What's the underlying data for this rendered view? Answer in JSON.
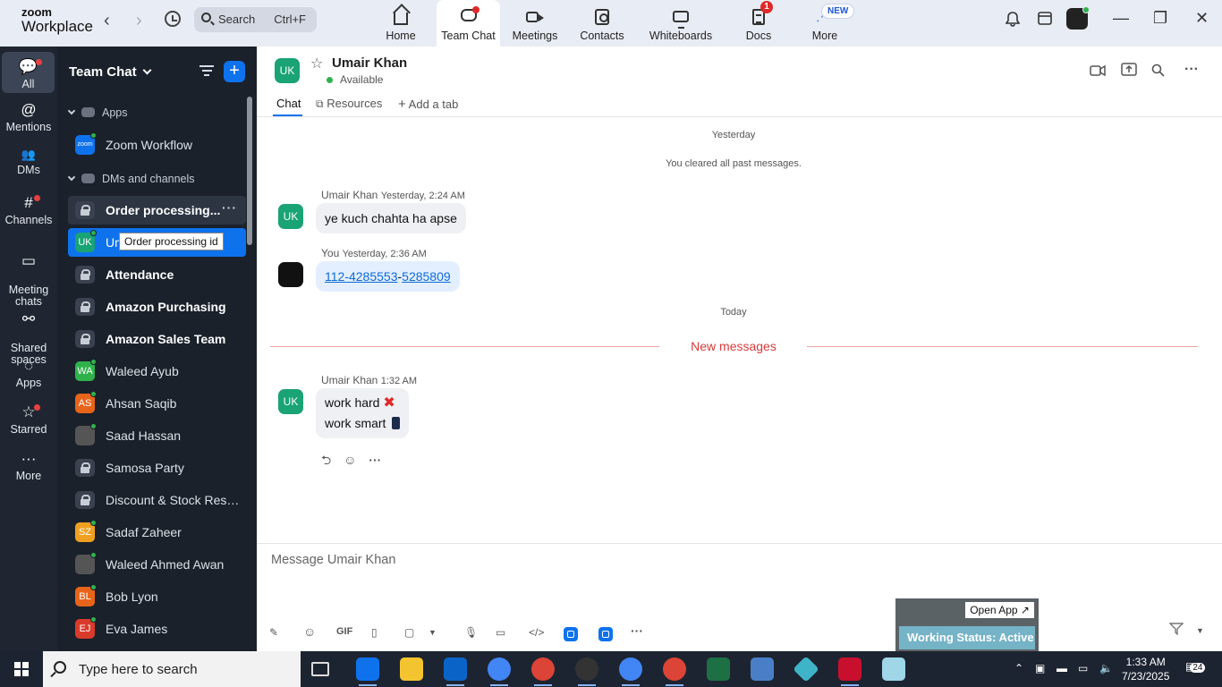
{
  "app": {
    "logo_line1": "zoom",
    "logo_line2": "Workplace"
  },
  "topbar": {
    "back": "‹",
    "forward": "›",
    "search": {
      "label": "Search",
      "shortcut": "Ctrl+F"
    },
    "tabs": [
      {
        "label": "Home"
      },
      {
        "label": "Team Chat"
      },
      {
        "label": "Meetings"
      },
      {
        "label": "Contacts"
      },
      {
        "label": "Whiteboards"
      },
      {
        "label": "Docs",
        "badge": "1"
      },
      {
        "label": "More",
        "badge": "NEW"
      }
    ],
    "window": {
      "minimize": "—",
      "restore": "❐",
      "close": "✕"
    }
  },
  "rail": [
    {
      "label": "All",
      "glyph": "💬"
    },
    {
      "label": "Mentions",
      "glyph": "@"
    },
    {
      "label": "DMs",
      "glyph": "👥"
    },
    {
      "label": "Channels",
      "glyph": "#"
    },
    {
      "label": "Meeting\nchats",
      "glyph": "▭"
    },
    {
      "label": "Shared\nspaces",
      "glyph": "⚯"
    },
    {
      "label": "Apps",
      "glyph": "◌"
    },
    {
      "label": "Starred",
      "glyph": "☆"
    },
    {
      "label": "More",
      "glyph": "···"
    }
  ],
  "channel_panel": {
    "title": "Team Chat",
    "plus": "+",
    "sections": {
      "apps": "Apps",
      "dms": "DMs and channels"
    },
    "apps": [
      {
        "name": "Zoom Workflow",
        "avatar": "zoom"
      }
    ],
    "items": [
      {
        "name": "Order processing...",
        "type": "lock",
        "bold": true
      },
      {
        "name": "Umair Khan",
        "type": "avatar",
        "initials": "UK",
        "color": "#1aa374",
        "selected": true
      },
      {
        "name": "Attendance",
        "type": "lock",
        "bold": true
      },
      {
        "name": "Amazon Purchasing",
        "type": "lock",
        "bold": true
      },
      {
        "name": "Amazon Sales Team",
        "type": "lock",
        "bold": true
      },
      {
        "name": "Waleed Ayub",
        "type": "avatar",
        "initials": "WA",
        "color": "#2fb24c"
      },
      {
        "name": "Ahsan Saqib",
        "type": "avatar",
        "initials": "AS",
        "color": "#e8641a"
      },
      {
        "name": "Saad Hassan",
        "type": "photo"
      },
      {
        "name": "Samosa Party",
        "type": "lock"
      },
      {
        "name": "Discount & Stock Reser...",
        "type": "lock"
      },
      {
        "name": "Sadaf Zaheer",
        "type": "avatar",
        "initials": "SZ",
        "color": "#f0a020"
      },
      {
        "name": "Waleed Ahmed Awan",
        "type": "photo"
      },
      {
        "name": "Bob Lyon",
        "type": "avatar",
        "initials": "BL",
        "color": "#e8641a"
      },
      {
        "name": "Eva James",
        "type": "avatar",
        "initials": "EJ",
        "color": "#d93b2b"
      }
    ],
    "more_dots": "···",
    "tooltip": "Order processing id"
  },
  "chat": {
    "header": {
      "initials": "UK",
      "name": "Umair Khan",
      "status": "Available"
    },
    "tabs": {
      "chat": "Chat",
      "resources": "Resources",
      "add": "Add a tab"
    },
    "yesterday": "Yesterday",
    "cleared": "You cleared all past messages.",
    "today": "Today",
    "new_messages": "New messages",
    "messages": [
      {
        "sender": "Umair Khan",
        "time": "Yesterday, 2:24 AM",
        "initials": "UK",
        "text": "ye kuch chahta ha apse"
      },
      {
        "sender": "You",
        "time": "Yesterday, 2:36 AM",
        "link1": "112-4285553",
        "sep": "-",
        "link2": "5285809"
      },
      {
        "sender": "Umair Khan",
        "time": "1:32 AM",
        "initials": "UK",
        "line1": "work hard",
        "line2": "work smart"
      }
    ],
    "compose_placeholder": "Message Umair Khan",
    "toolbar_gif": "GIF",
    "open_app": "Open App ↗",
    "working_status": "Working Status: Active"
  },
  "taskbar": {
    "search_placeholder": "Type here to search",
    "time": "1:33 AM",
    "date": "7/23/2025",
    "notif": "24"
  },
  "colors": {
    "accent": "#0e72ed",
    "uk_avatar": "#1aa374",
    "new_messages": "#d63b3b"
  }
}
